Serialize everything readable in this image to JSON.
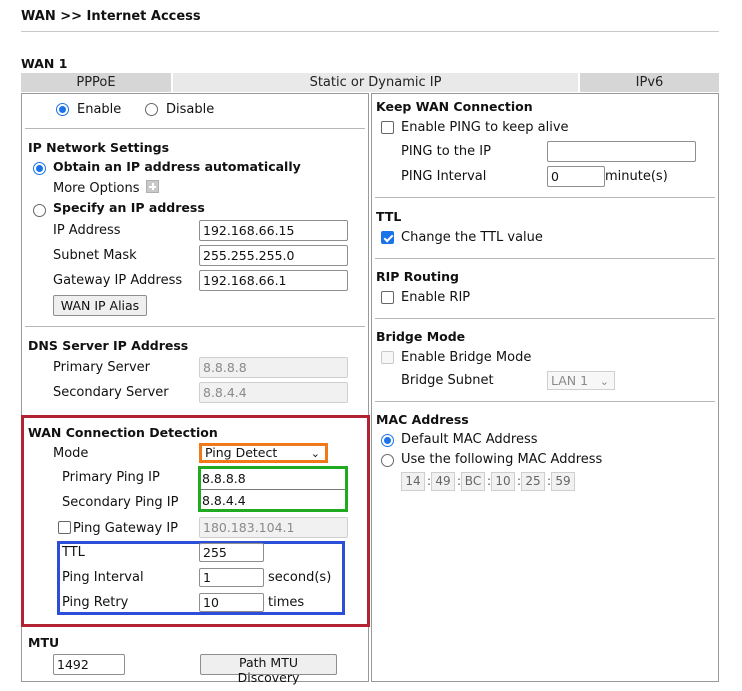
{
  "breadcrumb": "WAN >> Internet Access",
  "section_title": "WAN 1",
  "tabs": [
    "PPPoE",
    "Static or Dynamic IP",
    "IPv6"
  ],
  "enable": {
    "enable_label": "Enable",
    "disable_label": "Disable",
    "selected": "Enable"
  },
  "ip_settings": {
    "title": "IP Network Settings",
    "obtain_label": "Obtain an IP address automatically",
    "more_options": "More Options",
    "specify_label": "Specify an IP address",
    "ip_label": "IP Address",
    "ip_value": "192.168.66.15",
    "mask_label": "Subnet Mask",
    "mask_value": "255.255.255.0",
    "gw_label": "Gateway IP Address",
    "gw_value": "192.168.66.1",
    "alias_button": "WAN IP Alias"
  },
  "dns": {
    "title": "DNS Server IP Address",
    "primary_label": "Primary Server",
    "primary_value": "8.8.8.8",
    "secondary_label": "Secondary Server",
    "secondary_value": "8.8.4.4"
  },
  "detection": {
    "title": "WAN Connection Detection",
    "mode_label": "Mode",
    "mode_value": "Ping Detect",
    "primary_ping_label": "Primary Ping IP",
    "primary_ping_value": "8.8.8.8",
    "secondary_ping_label": "Secondary Ping IP",
    "secondary_ping_value": "8.8.4.4",
    "ping_gw_label": "Ping Gateway IP",
    "ping_gw_value": "180.183.104.1",
    "ttl_label": "TTL",
    "ttl_value": "255",
    "interval_label": "Ping Interval",
    "interval_value": "1",
    "interval_unit": "second(s)",
    "retry_label": "Ping Retry",
    "retry_value": "10",
    "retry_unit": "times"
  },
  "mtu": {
    "title": "MTU",
    "value": "1492",
    "button": "Path MTU Discovery"
  },
  "keep_wan": {
    "title": "Keep WAN Connection",
    "enable_ping_label": "Enable PING to keep alive",
    "ping_ip_label": "PING to the IP",
    "ping_ip_value": "",
    "interval_label": "PING Interval",
    "interval_value": "0",
    "interval_unit": "minute(s)"
  },
  "ttl": {
    "title": "TTL",
    "change_label": "Change the TTL value"
  },
  "rip": {
    "title": "RIP Routing",
    "enable_label": "Enable RIP"
  },
  "bridge": {
    "title": "Bridge Mode",
    "enable_label": "Enable Bridge Mode",
    "subnet_label": "Bridge Subnet",
    "subnet_value": "LAN 1"
  },
  "mac": {
    "title": "MAC Address",
    "default_label": "Default MAC Address",
    "following_label": "Use the following MAC Address",
    "octets": [
      "14",
      "49",
      "BC",
      "10",
      "25",
      "59"
    ]
  },
  "colors": {
    "red_box": "#b22232",
    "orange_box": "#f07a1a",
    "green_box": "#1faa1f",
    "blue_box": "#2b4fd8",
    "accent": "#1a73e8"
  },
  "icons": [
    "plus-icon",
    "chevron-down-icon"
  ]
}
